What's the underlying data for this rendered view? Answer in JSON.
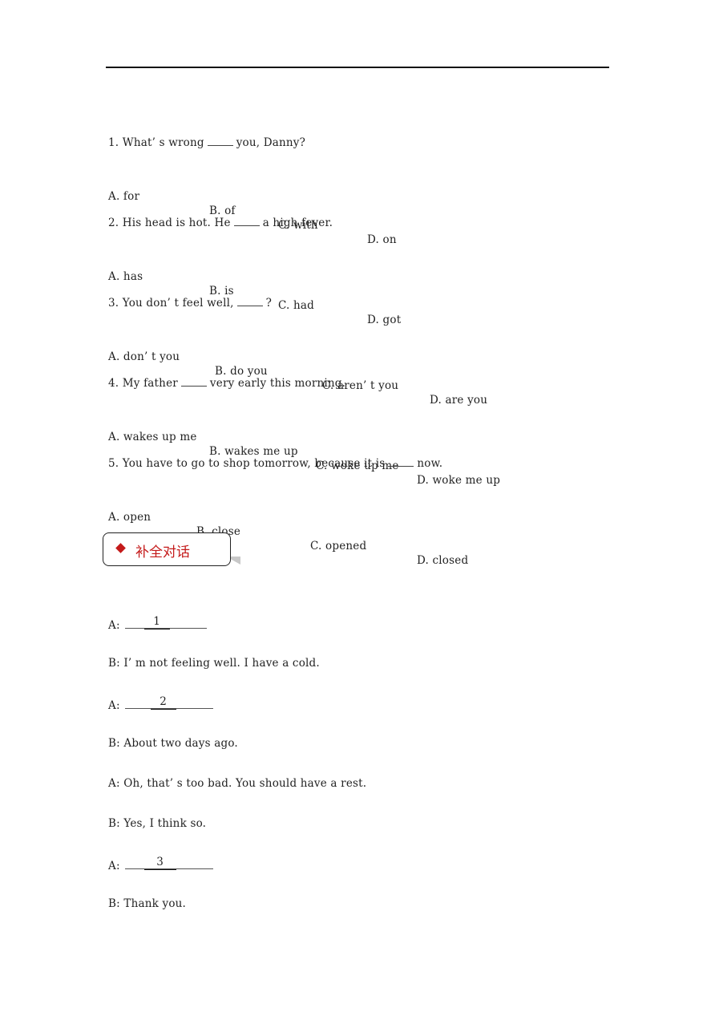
{
  "multiple_choice": [
    {
      "question": "1. What’ s wrong ____ you, Danny?",
      "stem_before": "1. What’ s wrong",
      "stem_after": "you, Danny?",
      "options": [
        "A. for",
        "B. of",
        "C. with",
        "D. on"
      ]
    },
    {
      "stem_before": "2. His head is hot. He",
      "stem_after": "a high fever.",
      "options": [
        "A. has",
        "B. is",
        "C. had",
        "D. got"
      ]
    },
    {
      "stem_before": "3. You don’ t feel well,",
      "stem_after": "?",
      "options": [
        "A. don’ t you",
        "B. do you",
        "C. aren’ t you",
        "D. are you"
      ]
    },
    {
      "stem_before": "4. My father",
      "stem_after": "very early this morning.",
      "options": [
        "A. wakes up me",
        "B. wakes me up",
        "C. woke up me",
        "D. woke me up"
      ]
    },
    {
      "stem_before": "5. You have to go to shop tomorrow, because it is",
      "stem_after": "now.",
      "options": [
        "A. open",
        "B. close",
        "C. opened",
        "D. closed"
      ]
    }
  ],
  "section": {
    "title": "补全对话",
    "icon": "diamond-icon",
    "accent_color": "#c41a1a"
  },
  "dialogue": [
    {
      "speaker": "A:",
      "blank_number": "1"
    },
    {
      "speaker": "B:",
      "text": "I’ m not feeling well. I have a cold."
    },
    {
      "speaker": "A:",
      "blank_number": "2"
    },
    {
      "speaker": "B:",
      "text": "About two days ago."
    },
    {
      "speaker": "A:",
      "text": "Oh, that’ s too bad. You should have a rest."
    },
    {
      "speaker": "B:",
      "text": "Yes, I think so."
    },
    {
      "speaker": "A:",
      "blank_number": "3"
    },
    {
      "speaker": "B:",
      "text": "Thank you."
    }
  ]
}
